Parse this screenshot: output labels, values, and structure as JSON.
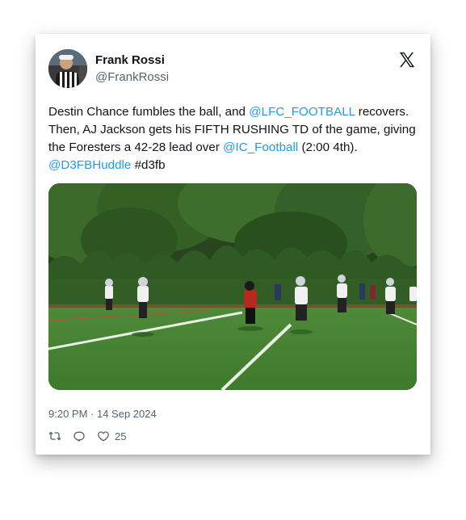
{
  "author": {
    "name": "Frank Rossi",
    "handle": "@FrankRossi"
  },
  "platform_icon": "x-logo-icon",
  "tweet": {
    "text_1": "Destin Chance fumbles the ball, and ",
    "mention_1": "@LFC_FOOTBALL",
    "text_2": " recovers. Then, AJ Jackson gets his FIFTH RUSHING TD of the game, giving the Foresters a 42-28 lead over ",
    "mention_2": "@IC_Football",
    "text_3": " (2:00 4th). ",
    "mention_3": "@D3FBHuddle",
    "text_4": " #d3fb"
  },
  "media": {
    "icon": "football-game-photo"
  },
  "timestamp": "9:20 PM · 14 Sep 2024",
  "actions": {
    "retweet_icon": "retweet-icon",
    "reply_icon": "reply-icon",
    "like_icon": "heart-icon",
    "like_count": "25"
  },
  "colors": {
    "link": "#1d9bf0",
    "text": "#0f1419",
    "muted": "#536471"
  }
}
